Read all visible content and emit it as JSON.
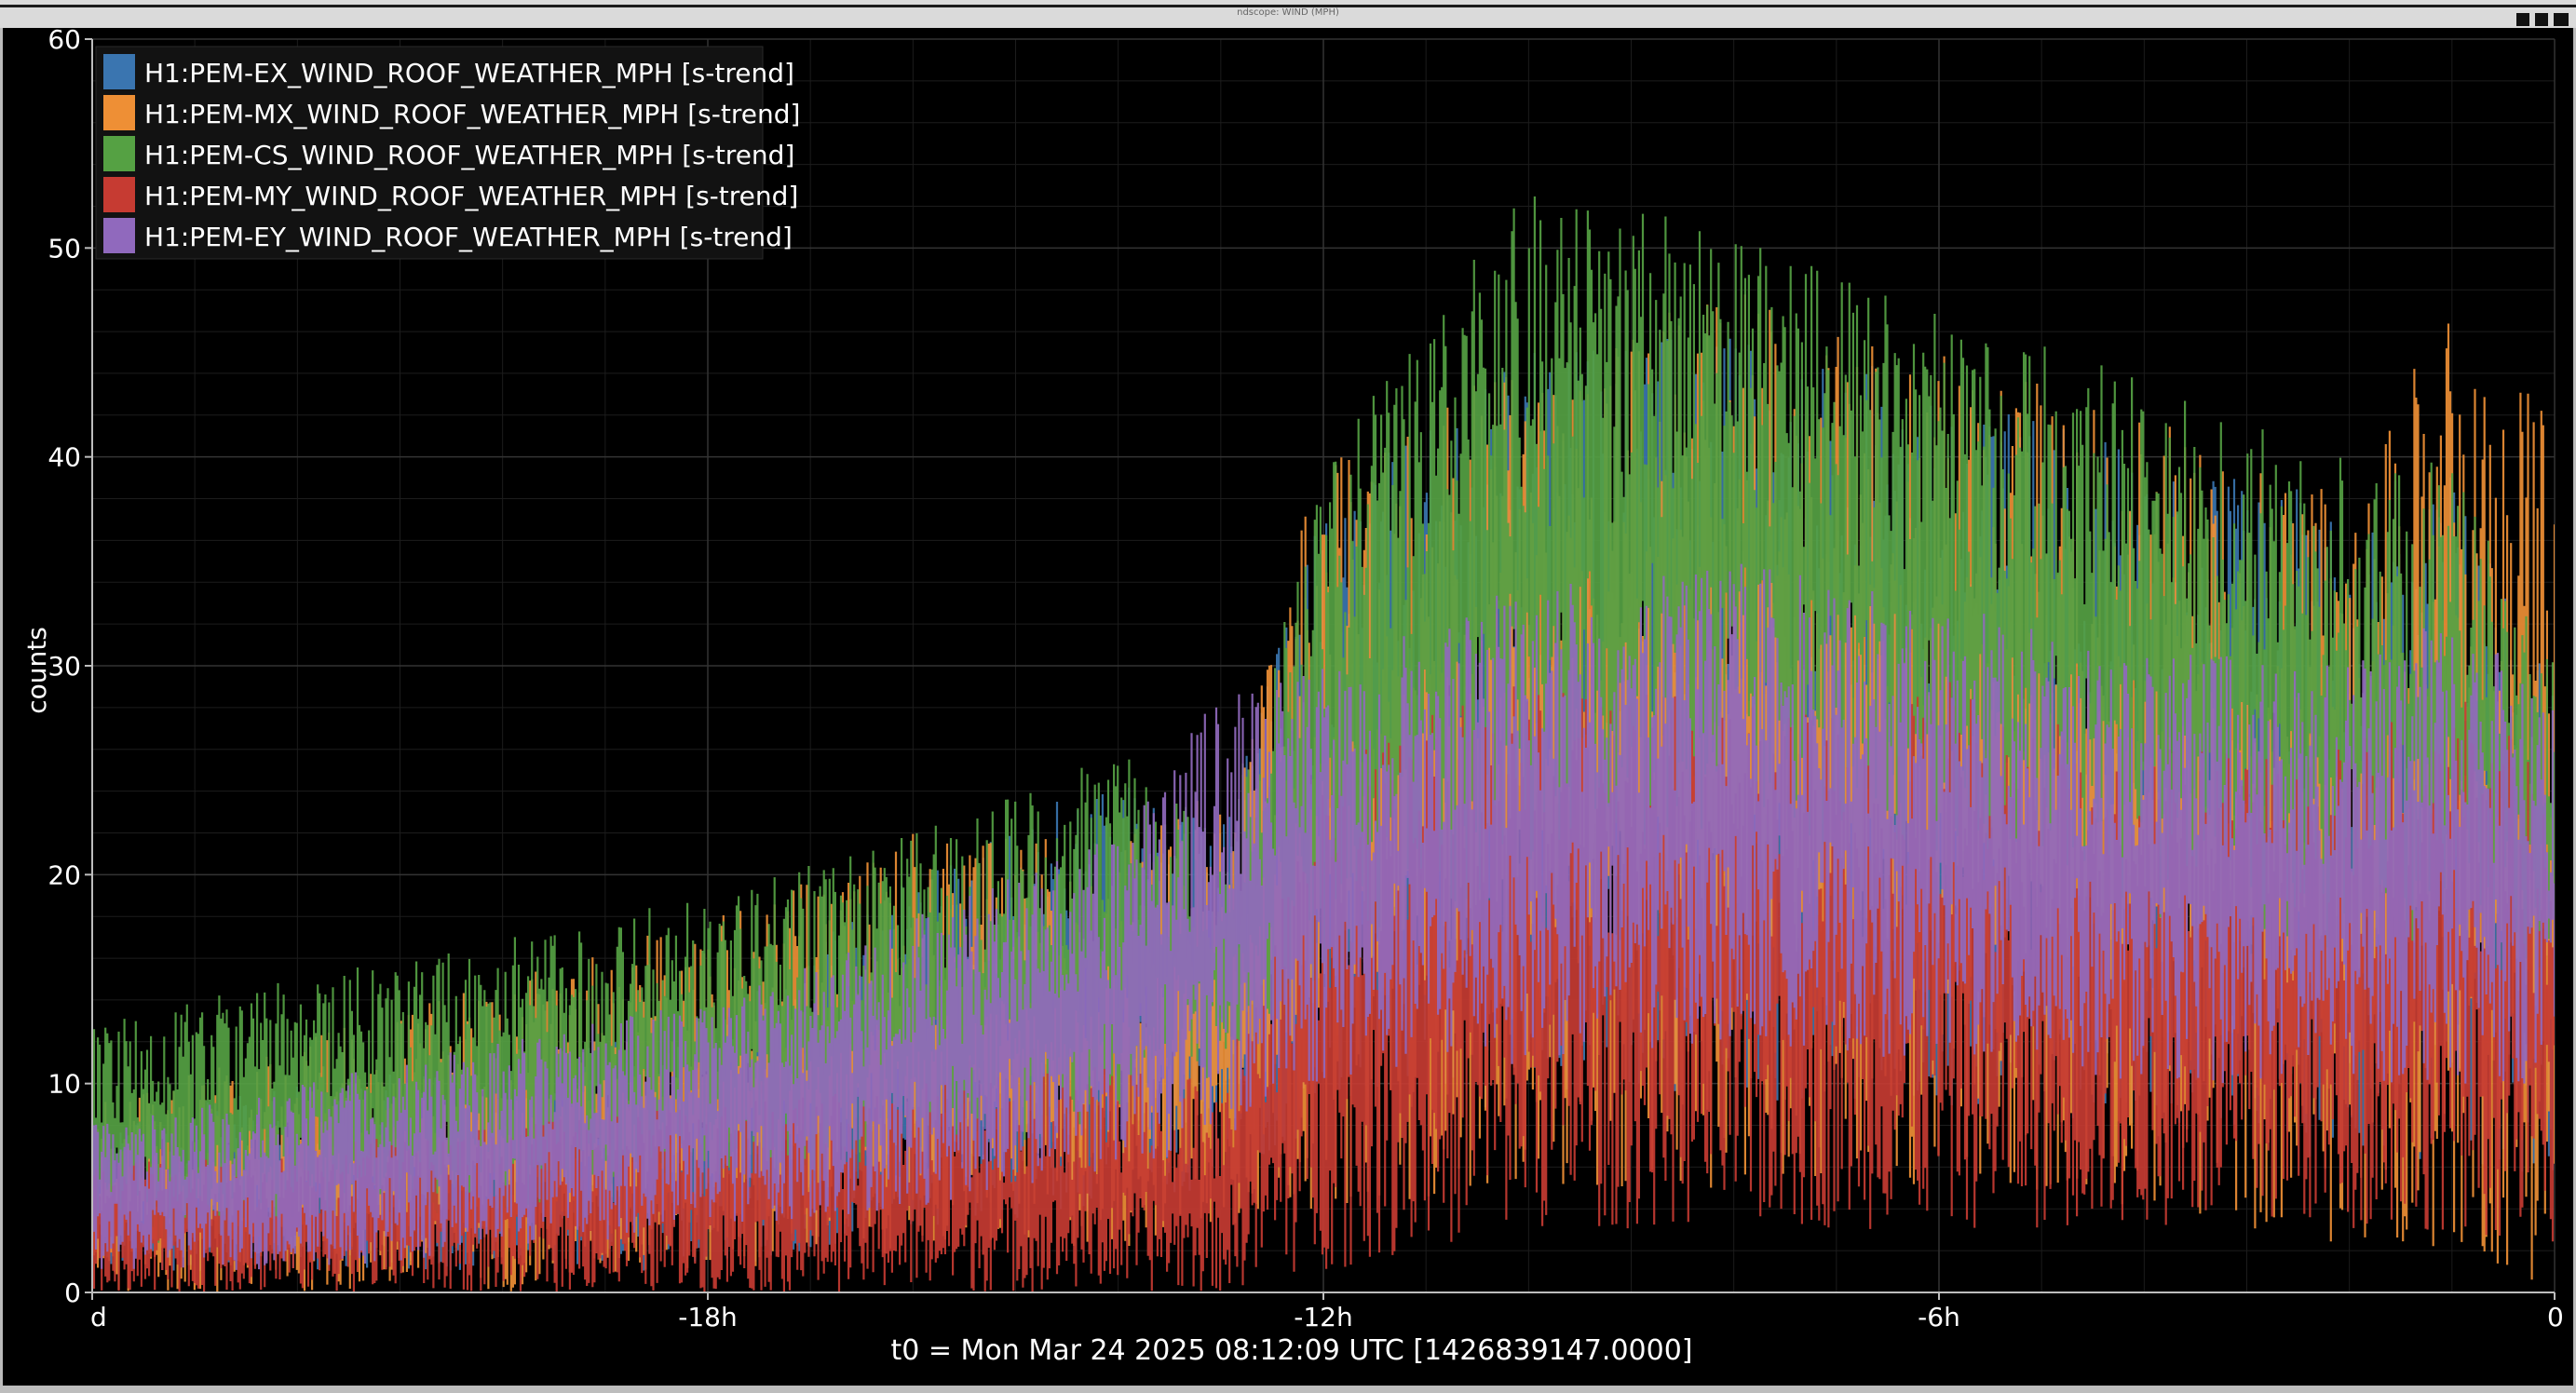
{
  "window": {
    "title": "ndscope: WIND (MPH)"
  },
  "chart_data": {
    "type": "line",
    "title": "",
    "xlabel": "t0 = Mon Mar 24 2025 08:12:09 UTC [1426839147.0000]",
    "ylabel": "counts",
    "x_unit": "hours relative to t0",
    "xlim": [
      -24,
      0
    ],
    "ylim": [
      0,
      60
    ],
    "x_ticks": [
      -24,
      -18,
      -12,
      -6,
      0
    ],
    "x_tick_labels": [
      "d",
      "-18h",
      "-12h",
      "-6h",
      "0"
    ],
    "y_ticks": [
      0,
      10,
      20,
      30,
      40,
      50,
      60
    ],
    "y_tick_labels": [
      "0",
      "10",
      "20",
      "30",
      "40",
      "50",
      "60"
    ],
    "grid": true,
    "legend_position": "top-left",
    "series": [
      {
        "name": "H1:PEM-EX_WIND_ROOF_WEATHER_MPH [s-trend]",
        "color": "#3a75b0",
        "x": [
          -24,
          -22,
          -20,
          -18,
          -16,
          -14,
          -13,
          -12,
          -10,
          -8,
          -6,
          -4,
          -2,
          -1,
          0
        ],
        "min": [
          1,
          1,
          1,
          1,
          3,
          4,
          5,
          8,
          9,
          9,
          9,
          8,
          6,
          6,
          5
        ],
        "max": [
          8,
          10,
          11,
          13,
          20,
          25,
          22,
          38,
          45,
          46,
          44,
          40,
          38,
          40,
          30
        ]
      },
      {
        "name": "H1:PEM-MX_WIND_ROOF_WEATHER_MPH [s-trend]",
        "color": "#ee8f35",
        "x": [
          -24,
          -22,
          -20,
          -18,
          -16,
          -14,
          -13,
          -12,
          -10,
          -8,
          -6,
          -4,
          -2,
          -1,
          0
        ],
        "min": [
          0,
          0,
          0,
          1,
          2,
          2,
          3,
          4,
          5,
          5,
          5,
          4,
          2,
          2,
          0
        ],
        "max": [
          9,
          12,
          15,
          18,
          22,
          22,
          24,
          40,
          45,
          48,
          45,
          42,
          38,
          48,
          42
        ]
      },
      {
        "name": "H1:PEM-CS_WIND_ROOF_WEATHER_MPH [s-trend]",
        "color": "#55a143",
        "x": [
          -24,
          -22,
          -20,
          -18,
          -16,
          -14,
          -13,
          -12,
          -10,
          -8,
          -6,
          -4,
          -2,
          -1,
          0
        ],
        "min": [
          2,
          3,
          4,
          5,
          6,
          8,
          10,
          15,
          20,
          22,
          20,
          18,
          16,
          16,
          15
        ],
        "max": [
          13,
          15,
          17,
          19,
          22,
          26,
          22,
          40,
          53,
          51,
          47,
          44,
          40,
          40,
          30
        ]
      },
      {
        "name": "H1:PEM-MY_WIND_ROOF_WEATHER_MPH [s-trend]",
        "color": "#c63b32",
        "x": [
          -24,
          -22,
          -20,
          -18,
          -16,
          -14,
          -13,
          -12,
          -10,
          -8,
          -6,
          -4,
          -2,
          -1,
          0
        ],
        "min": [
          0,
          0,
          0,
          0,
          0,
          0,
          0,
          1,
          3,
          3,
          3,
          3,
          3,
          3,
          2
        ],
        "max": [
          6,
          7,
          8,
          9,
          10,
          11,
          10,
          25,
          30,
          28,
          30,
          26,
          26,
          30,
          24
        ]
      },
      {
        "name": "H1:PEM-EY_WIND_ROOF_WEATHER_MPH [s-trend]",
        "color": "#9069bd",
        "x": [
          -24,
          -22,
          -20,
          -18,
          -16,
          -14,
          -13,
          -12,
          -10,
          -8,
          -6,
          -4,
          -2,
          -1,
          0
        ],
        "min": [
          1,
          1,
          2,
          3,
          4,
          6,
          7,
          10,
          11,
          12,
          11,
          10,
          10,
          10,
          10
        ],
        "max": [
          8,
          10,
          12,
          14,
          18,
          22,
          29,
          30,
          34,
          35,
          33,
          31,
          30,
          33,
          28
        ]
      }
    ]
  }
}
